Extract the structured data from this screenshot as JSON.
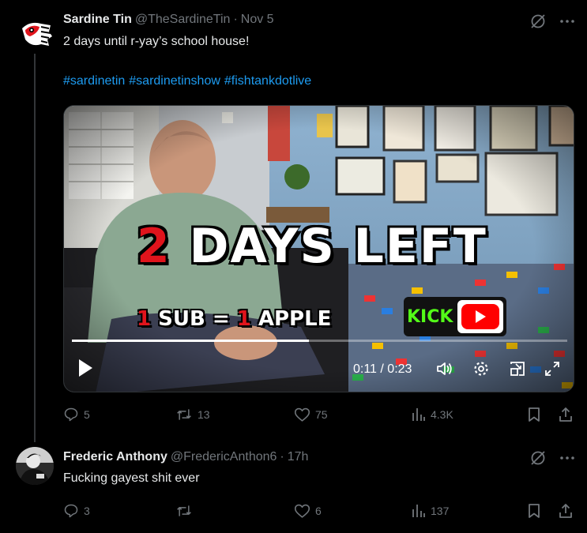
{
  "tweet1": {
    "display_name": "Sardine Tin",
    "handle": "@TheSardineTin",
    "separator": "·",
    "timestamp": "Nov 5",
    "text": "2 days until r-yay’s school house!",
    "hashtags": [
      "#sardinetin",
      "#sardinetinshow",
      "#fishtankdotlive"
    ],
    "video": {
      "overlay_title_num": "2",
      "overlay_title_rest": " DAYS LEFT",
      "overlay_sub_num1": "1",
      "overlay_sub_mid": " SUB = ",
      "overlay_sub_num2": "1",
      "overlay_sub_rest": " APPLE",
      "kick_label": "KICK",
      "time": "0:11 / 0:23",
      "progress": 0.4783
    },
    "actions": {
      "replies": "5",
      "reposts": "13",
      "likes": "75",
      "views": "4.3K"
    }
  },
  "tweet2": {
    "display_name": "Frederic Anthony",
    "handle": "@FredericAnthon6",
    "separator": "·",
    "timestamp": "17h",
    "text": "Fucking gayest shit ever",
    "actions": {
      "replies": "3",
      "reposts": "",
      "likes": "6",
      "views": "137"
    }
  },
  "colors": {
    "background": "#000000",
    "text_primary": "#e7e9ea",
    "text_secondary": "#71767b",
    "link": "#1d9bf0",
    "thread_line": "#333639"
  }
}
